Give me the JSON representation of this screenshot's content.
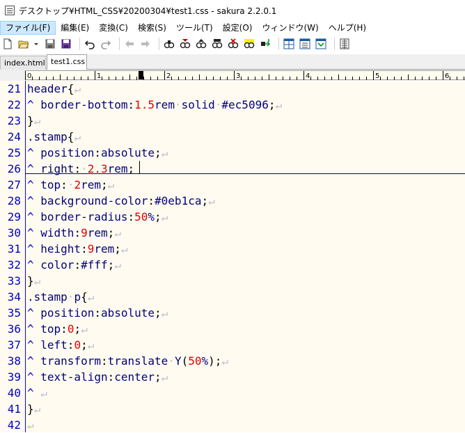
{
  "window": {
    "title": "デスクトップ¥HTML_CSS¥20200304¥test1.css - sakura 2.2.0.1"
  },
  "menu": [
    {
      "label": "ファイル(F)",
      "active": true
    },
    {
      "label": "編集(E)"
    },
    {
      "label": "変換(C)"
    },
    {
      "label": "検索(S)"
    },
    {
      "label": "ツール(T)"
    },
    {
      "label": "設定(O)"
    },
    {
      "label": "ウィンドウ(W)"
    },
    {
      "label": "ヘルプ(H)"
    }
  ],
  "toolbar": {
    "icons": [
      "new-file-icon",
      "open-file-icon",
      "dropdown-arrow-icon",
      "save-icon",
      "save-all-icon",
      "undo-icon",
      "redo-icon",
      "jump-back-icon",
      "jump-forward-icon",
      "search-icon",
      "search-next-icon",
      "search-prev-icon",
      "replace-icon",
      "grep-icon",
      "highlight-icon",
      "tag-jump-icon",
      "split-window-icon",
      "window-list-icon",
      "macro-icon",
      "settings-panel-icon"
    ]
  },
  "tabs": [
    {
      "label": "index.html",
      "active": false
    },
    {
      "label": "test1.css",
      "active": true
    }
  ],
  "ruler": {
    "labels": [
      "0",
      "1",
      "2",
      "3",
      "4",
      "5",
      "6"
    ]
  },
  "editor": {
    "cursor_line": 26,
    "lines": [
      {
        "n": "21",
        "t": [
          [
            "sel",
            "header"
          ],
          [
            "punct",
            "{"
          ],
          [
            "eol",
            "↵"
          ]
        ]
      },
      {
        "n": "22",
        "t": [
          [
            "indent",
            "^ "
          ],
          [
            "prop",
            "border-bottom"
          ],
          [
            "punct",
            ":"
          ],
          [
            "num",
            "1.5"
          ],
          [
            "val",
            "rem"
          ],
          [
            "sp",
            "·"
          ],
          [
            "val",
            "solid"
          ],
          [
            "sp",
            "·"
          ],
          [
            "val",
            "#ec5096"
          ],
          [
            "punct",
            ";"
          ],
          [
            "eol",
            "↵"
          ]
        ]
      },
      {
        "n": "23",
        "t": [
          [
            "punct",
            "}"
          ],
          [
            "eol",
            "↵"
          ]
        ]
      },
      {
        "n": "24",
        "t": [
          [
            "sel",
            ".stamp"
          ],
          [
            "punct",
            "{"
          ],
          [
            "eol",
            "↵"
          ]
        ]
      },
      {
        "n": "25",
        "t": [
          [
            "indent",
            "^ "
          ],
          [
            "prop",
            "position"
          ],
          [
            "punct",
            ":"
          ],
          [
            "val",
            "absolute"
          ],
          [
            "punct",
            ";"
          ],
          [
            "eol",
            "↵"
          ]
        ]
      },
      {
        "n": "26",
        "t": [
          [
            "indent",
            "^ "
          ],
          [
            "prop",
            "right"
          ],
          [
            "punct",
            ":"
          ],
          [
            "sp",
            "·"
          ],
          [
            "num",
            "2.3"
          ],
          [
            "val",
            "rem"
          ],
          [
            "punct",
            ";"
          ]
        ]
      },
      {
        "n": "27",
        "t": [
          [
            "indent",
            "^ "
          ],
          [
            "prop",
            "top"
          ],
          [
            "punct",
            ":"
          ],
          [
            "sp",
            "·"
          ],
          [
            "num",
            "2"
          ],
          [
            "val",
            "rem"
          ],
          [
            "punct",
            ";"
          ],
          [
            "eol",
            "↵"
          ]
        ]
      },
      {
        "n": "28",
        "t": [
          [
            "indent",
            "^ "
          ],
          [
            "prop",
            "background-color"
          ],
          [
            "punct",
            ":"
          ],
          [
            "val",
            "#0eb1ca"
          ],
          [
            "punct",
            ";"
          ],
          [
            "eol",
            "↵"
          ]
        ]
      },
      {
        "n": "29",
        "t": [
          [
            "indent",
            "^ "
          ],
          [
            "prop",
            "border-radius"
          ],
          [
            "punct",
            ":"
          ],
          [
            "num",
            "50"
          ],
          [
            "val",
            "%"
          ],
          [
            "punct",
            ";"
          ],
          [
            "eol",
            "↵"
          ]
        ]
      },
      {
        "n": "30",
        "t": [
          [
            "indent",
            "^ "
          ],
          [
            "prop",
            "width"
          ],
          [
            "punct",
            ":"
          ],
          [
            "num",
            "9"
          ],
          [
            "val",
            "rem"
          ],
          [
            "punct",
            ";"
          ],
          [
            "eol",
            "↵"
          ]
        ]
      },
      {
        "n": "31",
        "t": [
          [
            "indent",
            "^ "
          ],
          [
            "prop",
            "height"
          ],
          [
            "punct",
            ":"
          ],
          [
            "num",
            "9"
          ],
          [
            "val",
            "rem"
          ],
          [
            "punct",
            ";"
          ],
          [
            "eol",
            "↵"
          ]
        ]
      },
      {
        "n": "32",
        "t": [
          [
            "indent",
            "^ "
          ],
          [
            "prop",
            "color"
          ],
          [
            "punct",
            ":"
          ],
          [
            "val",
            "#fff"
          ],
          [
            "punct",
            ";"
          ],
          [
            "eol",
            "↵"
          ]
        ]
      },
      {
        "n": "33",
        "t": [
          [
            "punct",
            "}"
          ],
          [
            "eol",
            "↵"
          ]
        ]
      },
      {
        "n": "34",
        "t": [
          [
            "sel",
            ".stamp"
          ],
          [
            "sp",
            "·"
          ],
          [
            "sel",
            "p"
          ],
          [
            "punct",
            "{"
          ],
          [
            "eol",
            "↵"
          ]
        ]
      },
      {
        "n": "35",
        "t": [
          [
            "indent",
            "^ "
          ],
          [
            "prop",
            "position"
          ],
          [
            "punct",
            ":"
          ],
          [
            "val",
            "absolute"
          ],
          [
            "punct",
            ";"
          ],
          [
            "eol",
            "↵"
          ]
        ]
      },
      {
        "n": "36",
        "t": [
          [
            "indent",
            "^ "
          ],
          [
            "prop",
            "top"
          ],
          [
            "punct",
            ":"
          ],
          [
            "num",
            "0"
          ],
          [
            "punct",
            ";"
          ],
          [
            "eol",
            "↵"
          ]
        ]
      },
      {
        "n": "37",
        "t": [
          [
            "indent",
            "^ "
          ],
          [
            "prop",
            "left"
          ],
          [
            "punct",
            ":"
          ],
          [
            "num",
            "0"
          ],
          [
            "punct",
            ";"
          ],
          [
            "eol",
            "↵"
          ]
        ]
      },
      {
        "n": "38",
        "t": [
          [
            "indent",
            "^ "
          ],
          [
            "prop",
            "transform"
          ],
          [
            "punct",
            ":"
          ],
          [
            "val",
            "translate"
          ],
          [
            "sp",
            "·"
          ],
          [
            "val",
            "Y"
          ],
          [
            "punct",
            "("
          ],
          [
            "num",
            "50"
          ],
          [
            "val",
            "%"
          ],
          [
            "punct",
            ")"
          ],
          [
            "punct",
            ";"
          ],
          [
            "eol",
            "↵"
          ]
        ]
      },
      {
        "n": "39",
        "t": [
          [
            "indent",
            "^ "
          ],
          [
            "prop",
            "text-align"
          ],
          [
            "punct",
            ":"
          ],
          [
            "val",
            "center"
          ],
          [
            "punct",
            ";"
          ],
          [
            "eol",
            "↵"
          ]
        ]
      },
      {
        "n": "40",
        "t": [
          [
            "indent",
            "^ "
          ],
          [
            "eol",
            "↵"
          ]
        ]
      },
      {
        "n": "41",
        "t": [
          [
            "punct",
            "}"
          ],
          [
            "eol",
            "↵"
          ]
        ]
      },
      {
        "n": "42",
        "t": [
          [
            "eol",
            "↵"
          ]
        ]
      }
    ]
  }
}
